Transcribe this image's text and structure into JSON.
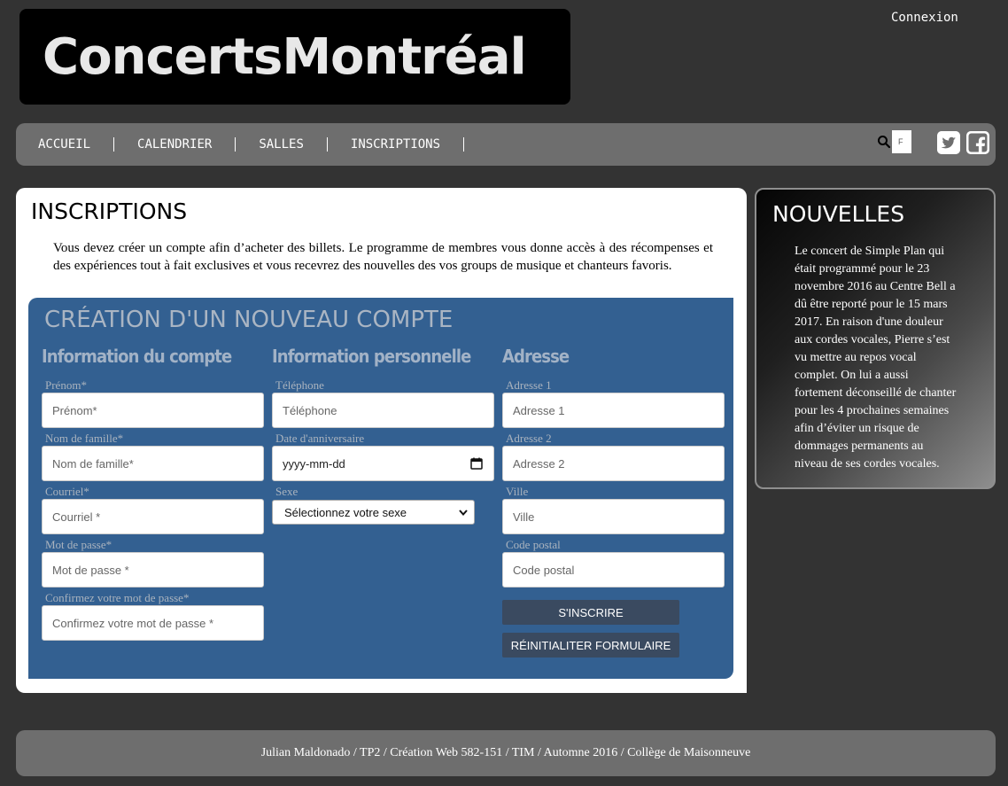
{
  "header": {
    "logo_text": "ConcertsMontréal",
    "login_label": "Connexion"
  },
  "nav": {
    "items": [
      {
        "label": "ACCUEIL"
      },
      {
        "label": "CALENDRIER"
      },
      {
        "label": "SALLES"
      },
      {
        "label": "INSCRIPTIONS"
      }
    ],
    "search_value": "F",
    "icons": [
      "search-icon",
      "twitter-icon",
      "facebook-icon"
    ]
  },
  "main": {
    "title": "INSCRIPTIONS",
    "intro": "Vous devez créer un compte afin d’acheter des billets. Le programme de membres vous donne accès à des récompenses et des expériences tout à fait exclusives et vous recevrez des nouvelles des vos groups de musique et chanteurs favoris."
  },
  "form": {
    "title": "CRÉATION D'UN NOUVEAU COMPTE",
    "account": {
      "heading": "Information du compte",
      "fields": [
        {
          "label": "Prénom*",
          "placeholder": "Prénom*"
        },
        {
          "label": "Nom de famille*",
          "placeholder": "Nom de famille*"
        },
        {
          "label": "Courriel*",
          "placeholder": "Courriel *"
        },
        {
          "label": "Mot de passe*",
          "placeholder": "Mot de passe *"
        },
        {
          "label": "Confirmez votre mot de passe*",
          "placeholder": "Confirmez votre mot de passe *"
        }
      ]
    },
    "personal": {
      "heading": "Information personnelle",
      "phone_label": "Téléphone",
      "phone_placeholder": "Téléphone",
      "birthday_label": "Date d'anniversaire",
      "birthday_value": "yyyy-mm-dd",
      "sex_label": "Sexe",
      "sex_selected": "Sélectionnez votre sexe"
    },
    "address": {
      "heading": "Adresse",
      "fields": [
        {
          "label": "Adresse 1",
          "placeholder": "Adresse 1"
        },
        {
          "label": "Adresse 2",
          "placeholder": "Adresse 2"
        },
        {
          "label": "Ville",
          "placeholder": "Ville"
        },
        {
          "label": "Code postal",
          "placeholder": "Code postal"
        }
      ]
    },
    "submit_label": "S'INSCRIRE",
    "reset_label": "RÉINITIALITER FORMULAIRE"
  },
  "news": {
    "title": "NOUVELLES",
    "body": "Le concert de Simple Plan qui était programmé pour le 23 novembre 2016 au Centre Bell a dû être reporté pour le 15 mars 2017. En raison d'une douleur aux cordes vocales, Pierre s’est vu mettre au repos vocal complet. On lui a aussi fortement déconseillé de chanter pour les 4 prochaines semaines afin d’éviter un risque de dommages permanents au niveau de ses cordes vocales."
  },
  "footer": {
    "text": "Julian Maldonado / TP2 / Création Web 582-151 / TIM / Automne 2016 / Collège de Maisonneuve"
  }
}
